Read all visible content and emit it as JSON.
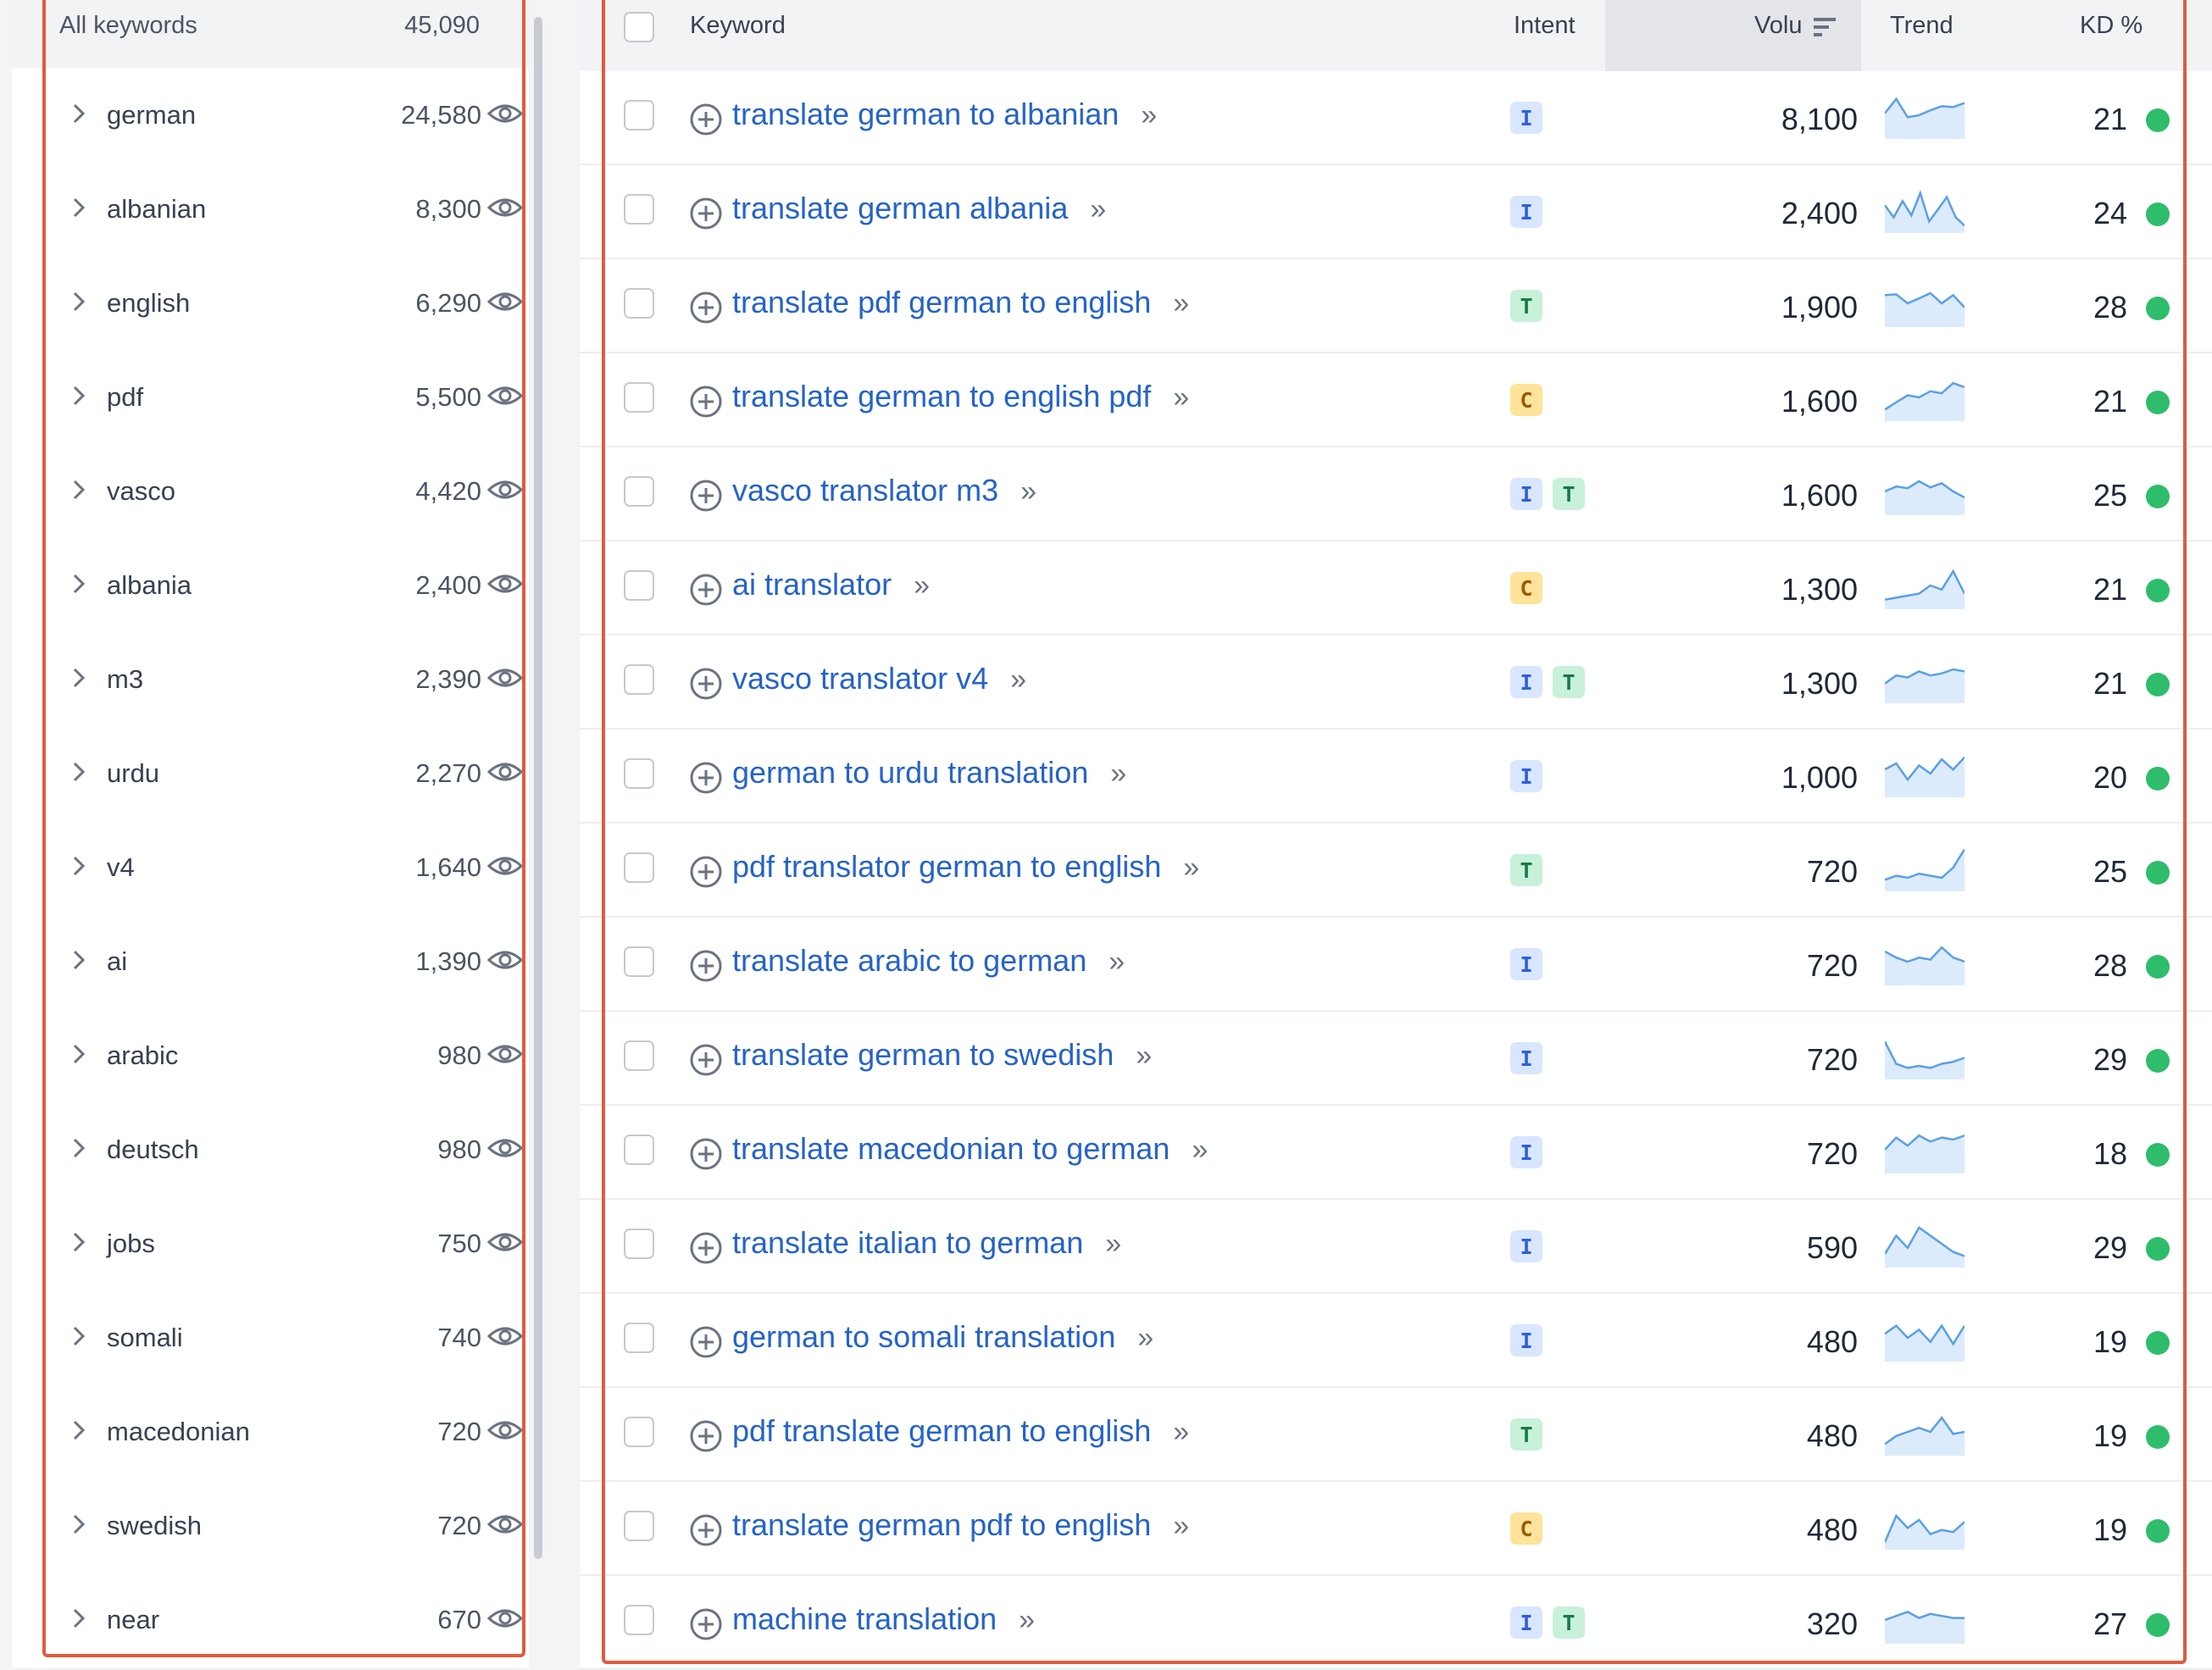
{
  "left_panel": {
    "header_label": "All keywords",
    "header_count": "45,090",
    "groups": [
      {
        "name": "german",
        "count": "24,580"
      },
      {
        "name": "albanian",
        "count": "8,300"
      },
      {
        "name": "english",
        "count": "6,290"
      },
      {
        "name": "pdf",
        "count": "5,500"
      },
      {
        "name": "vasco",
        "count": "4,420"
      },
      {
        "name": "albania",
        "count": "2,400"
      },
      {
        "name": "m3",
        "count": "2,390"
      },
      {
        "name": "urdu",
        "count": "2,270"
      },
      {
        "name": "v4",
        "count": "1,640"
      },
      {
        "name": "ai",
        "count": "1,390"
      },
      {
        "name": "arabic",
        "count": "980"
      },
      {
        "name": "deutsch",
        "count": "980"
      },
      {
        "name": "jobs",
        "count": "750"
      },
      {
        "name": "somali",
        "count": "740"
      },
      {
        "name": "macedonian",
        "count": "720"
      },
      {
        "name": "swedish",
        "count": "720"
      },
      {
        "name": "near",
        "count": "670"
      }
    ]
  },
  "table": {
    "headers": {
      "keyword": "Keyword",
      "intent": "Intent",
      "volume": "Volu",
      "trend": "Trend",
      "kd": "KD %"
    },
    "rows": [
      {
        "keyword": "translate german to albanian",
        "intents": [
          "I"
        ],
        "volume": "8,100",
        "kd": "21",
        "trend": [
          0.55,
          0.9,
          0.45,
          0.5,
          0.62,
          0.72,
          0.7,
          0.8
        ]
      },
      {
        "keyword": "translate german albania",
        "intents": [
          "I"
        ],
        "volume": "2,400",
        "kd": "24",
        "trend": [
          0.6,
          0.3,
          0.7,
          0.35,
          0.9,
          0.2,
          0.5,
          0.8,
          0.3,
          0.1
        ]
      },
      {
        "keyword": "translate pdf german to english",
        "intents": [
          "T"
        ],
        "volume": "1,900",
        "kd": "28",
        "trend": [
          0.7,
          0.72,
          0.5,
          0.62,
          0.75,
          0.5,
          0.7,
          0.4
        ]
      },
      {
        "keyword": "translate german to english pdf",
        "intents": [
          "C"
        ],
        "volume": "1,600",
        "kd": "21",
        "trend": [
          0.2,
          0.38,
          0.55,
          0.5,
          0.65,
          0.6,
          0.85,
          0.75
        ]
      },
      {
        "keyword": "vasco translator m3",
        "intents": [
          "I",
          "T"
        ],
        "volume": "1,600",
        "kd": "25",
        "trend": [
          0.5,
          0.62,
          0.58,
          0.75,
          0.6,
          0.7,
          0.5,
          0.35
        ]
      },
      {
        "keyword": "ai translator",
        "intents": [
          "C"
        ],
        "volume": "1,300",
        "kd": "21",
        "trend": [
          0.15,
          0.2,
          0.25,
          0.3,
          0.5,
          0.4,
          0.85,
          0.3
        ]
      },
      {
        "keyword": "vasco translator v4",
        "intents": [
          "I",
          "T"
        ],
        "volume": "1,300",
        "kd": "21",
        "trend": [
          0.4,
          0.6,
          0.55,
          0.7,
          0.6,
          0.65,
          0.75,
          0.7
        ]
      },
      {
        "keyword": "german to urdu translation",
        "intents": [
          "I"
        ],
        "volume": "1,000",
        "kd": "20",
        "trend": [
          0.6,
          0.75,
          0.35,
          0.7,
          0.5,
          0.85,
          0.6,
          0.9
        ]
      },
      {
        "keyword": "pdf translator german to english",
        "intents": [
          "T"
        ],
        "volume": "720",
        "kd": "25",
        "trend": [
          0.2,
          0.3,
          0.25,
          0.35,
          0.3,
          0.25,
          0.5,
          0.95
        ]
      },
      {
        "keyword": "translate arabic to german",
        "intents": [
          "I"
        ],
        "volume": "720",
        "kd": "28",
        "trend": [
          0.75,
          0.6,
          0.5,
          0.6,
          0.55,
          0.85,
          0.6,
          0.5
        ]
      },
      {
        "keyword": "translate german to swedish",
        "intents": [
          "I"
        ],
        "volume": "720",
        "kd": "29",
        "trend": [
          0.85,
          0.3,
          0.2,
          0.25,
          0.2,
          0.3,
          0.35,
          0.45
        ]
      },
      {
        "keyword": "translate macedonian to german",
        "intents": [
          "I"
        ],
        "volume": "720",
        "kd": "18",
        "trend": [
          0.5,
          0.8,
          0.6,
          0.85,
          0.7,
          0.8,
          0.75,
          0.85
        ]
      },
      {
        "keyword": "translate italian to german",
        "intents": [
          "I"
        ],
        "volume": "590",
        "kd": "29",
        "trend": [
          0.25,
          0.7,
          0.4,
          0.9,
          0.7,
          0.5,
          0.3,
          0.2
        ]
      },
      {
        "keyword": "german to somali translation",
        "intents": [
          "I"
        ],
        "volume": "480",
        "kd": "19",
        "trend": [
          0.6,
          0.8,
          0.5,
          0.7,
          0.4,
          0.8,
          0.35,
          0.8
        ]
      },
      {
        "keyword": "pdf translate german to english",
        "intents": [
          "T"
        ],
        "volume": "480",
        "kd": "19",
        "trend": [
          0.2,
          0.4,
          0.5,
          0.6,
          0.5,
          0.85,
          0.45,
          0.5
        ]
      },
      {
        "keyword": "translate german pdf to english",
        "intents": [
          "C"
        ],
        "volume": "480",
        "kd": "19",
        "trend": [
          0.1,
          0.75,
          0.45,
          0.65,
          0.3,
          0.4,
          0.35,
          0.6
        ]
      },
      {
        "keyword": "machine translation",
        "intents": [
          "I",
          "T"
        ],
        "volume": "320",
        "kd": "27",
        "trend": [
          0.5,
          0.6,
          0.7,
          0.55,
          0.65,
          0.6,
          0.55,
          0.55
        ]
      }
    ]
  },
  "colors": {
    "link": "#2563c9",
    "kd_easy": "#2ebd6b",
    "highlight_border": "#e05a3f",
    "trend_line": "#5aa0e6",
    "trend_fill": "#dcebfb"
  }
}
